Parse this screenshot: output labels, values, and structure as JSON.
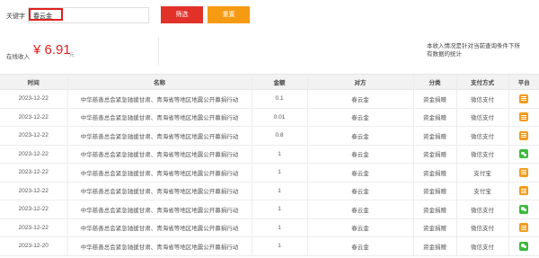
{
  "filter": {
    "keyword_label": "关键字",
    "keyword_value": "春云金",
    "search_label": "筛选",
    "reset_label": "重置"
  },
  "summary": {
    "income_label": "在线收入",
    "income_value": "¥ 6.91",
    "income_unit": "元",
    "note": "本收入情况是针对当前查询条件下所有数据的统计"
  },
  "table": {
    "headers": [
      "时间",
      "名称",
      "金额",
      "对方",
      "分类",
      "支付方式",
      "平台"
    ],
    "rows": [
      {
        "time": "2023-12-22",
        "name": "中华慈善总会紧急驰援甘肃、青海省等地区地震公开募捐行动",
        "amount": "0.1",
        "party": "春云金",
        "category": "资金捐赠",
        "payment": "微信支付",
        "platform_icon": "orange-app-icon"
      },
      {
        "time": "2023-12-22",
        "name": "中华慈善总会紧急驰援甘肃、青海省等地区地震公开募捐行动",
        "amount": "0.01",
        "party": "春云金",
        "category": "资金捐赠",
        "payment": "微信支付",
        "platform_icon": "orange-app-icon"
      },
      {
        "time": "2023-12-22",
        "name": "中华慈善总会紧急驰援甘肃、青海省等地区地震公开募捐行动",
        "amount": "0.8",
        "party": "春云金",
        "category": "资金捐赠",
        "payment": "微信支付",
        "platform_icon": "orange-app-icon"
      },
      {
        "time": "2023-12-22",
        "name": "中华慈善总会紧急驰援甘肃、青海省等地区地震公开募捐行动",
        "amount": "1",
        "party": "春云金",
        "category": "资金捐赠",
        "payment": "微信支付",
        "platform_icon": "wechat-icon"
      },
      {
        "time": "2023-12-22",
        "name": "中华慈善总会紧急驰援甘肃、青海省等地区地震公开募捐行动",
        "amount": "1",
        "party": "春云金",
        "category": "资金捐赠",
        "payment": "支付宝",
        "platform_icon": "orange-app-icon"
      },
      {
        "time": "2023-12-22",
        "name": "中华慈善总会紧急驰援甘肃、青海省等地区地震公开募捐行动",
        "amount": "1",
        "party": "春云金",
        "category": "资金捐赠",
        "payment": "支付宝",
        "platform_icon": "orange-app-icon"
      },
      {
        "time": "2023-12-22",
        "name": "中华慈善总会紧急驰援甘肃、青海省等地区地震公开募捐行动",
        "amount": "1",
        "party": "春云金",
        "category": "资金捐赠",
        "payment": "微信支付",
        "platform_icon": "wechat-icon"
      },
      {
        "time": "2023-12-22",
        "name": "中华慈善总会紧急驰援甘肃、青海省等地区地震公开募捐行动",
        "amount": "1",
        "party": "春云金",
        "category": "资金捐赠",
        "payment": "微信支付",
        "platform_icon": "orange-app-icon"
      },
      {
        "time": "2023-12-20",
        "name": "中华慈善总会紧急驰援甘肃、青海省等地区地震公开募捐行动",
        "amount": "1",
        "party": "春云金",
        "category": "资金捐赠",
        "payment": "微信支付",
        "platform_icon": "wechat-icon"
      }
    ]
  },
  "colors": {
    "accent_red": "#e23129",
    "accent_orange": "#f79a13",
    "amount_green": "#2aa83a",
    "income_red": "#e02020"
  }
}
